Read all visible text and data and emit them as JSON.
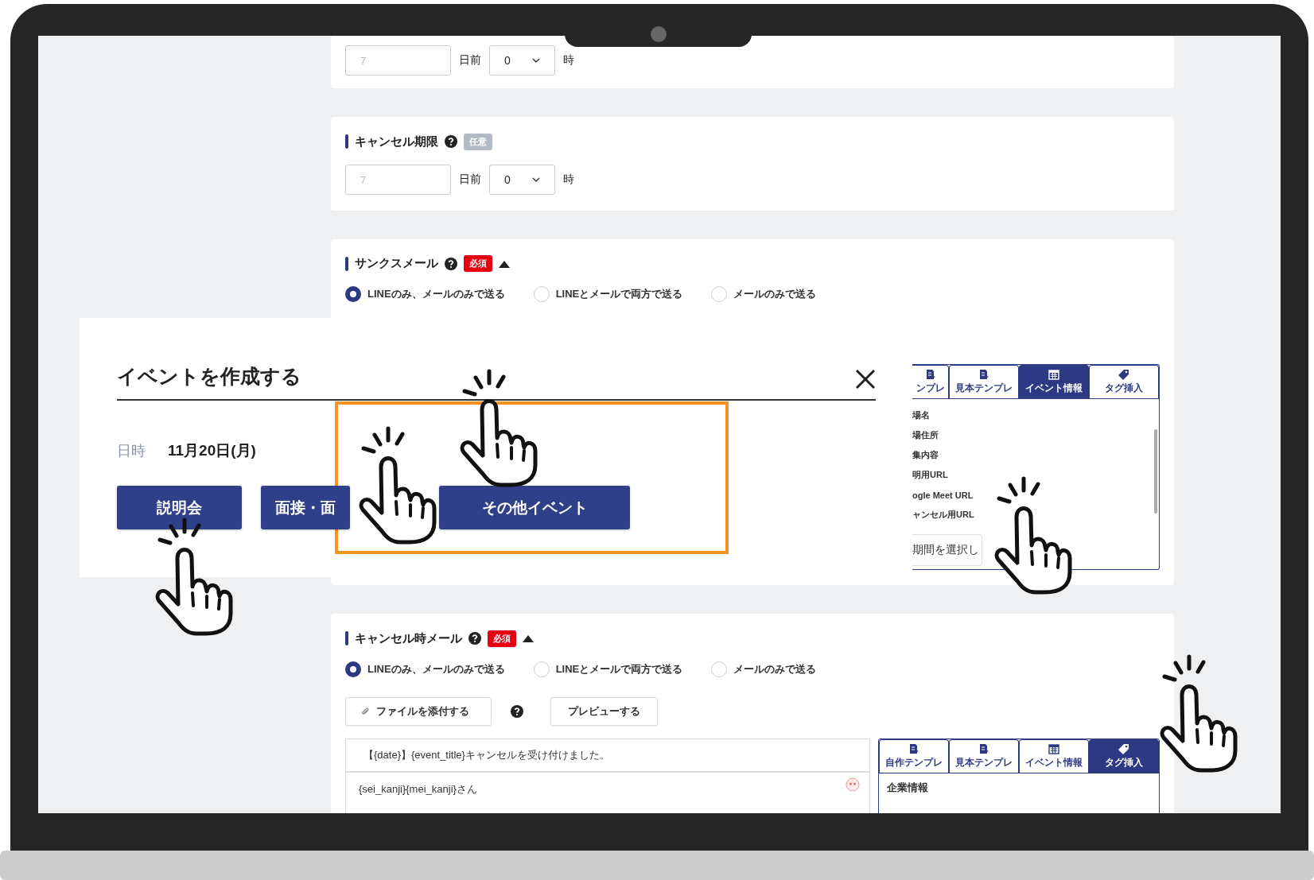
{
  "sections": [
    {
      "kind": "deadline",
      "days_placeholder": "7",
      "days_unit": "日前",
      "hour_value": "0",
      "hour_unit": "時"
    },
    {
      "kind": "deadline",
      "title": "キャンセル期限",
      "badge": {
        "text": "任意",
        "required": false
      },
      "days_placeholder": "7",
      "days_unit": "日前",
      "hour_value": "0",
      "hour_unit": "時"
    },
    {
      "kind": "mail",
      "title": "サンクスメール",
      "badge": {
        "text": "必須",
        "required": true
      },
      "expanded": true,
      "radios": [
        {
          "label": "LINEのみ、メールのみで送る",
          "selected": true
        },
        {
          "label": "LINEとメールで両方で送る",
          "selected": false
        },
        {
          "label": "メールのみで送る",
          "selected": false
        }
      ],
      "tag_panel": {
        "tabs": [
          {
            "label": "ンプレ",
            "selected": false
          },
          {
            "label": "見本テンプレ",
            "selected": false
          },
          {
            "label": "イベント情報",
            "selected": true
          },
          {
            "label": "タグ挿入",
            "selected": false
          }
        ],
        "items": [
          "場名",
          "場住所",
          "集内容",
          "明用URL",
          "ogle Meet URL",
          "ャンセル用URL"
        ],
        "select": "期間を選択し"
      }
    },
    {
      "kind": "mail",
      "title": "キャンセル時メール",
      "badge": {
        "text": "必須",
        "required": true
      },
      "expanded": true,
      "radios": [
        {
          "label": "LINEのみ、メールのみで送る",
          "selected": true
        },
        {
          "label": "LINEとメールで両方で送る",
          "selected": false
        },
        {
          "label": "メールのみで送る",
          "selected": false
        }
      ],
      "attach_button": "ファイルを添付する",
      "preview_button": "プレビューする",
      "editor": {
        "subject": "【{date}】{event_title}キャンセルを受け付けました。",
        "body": "{sei_kanji}{mei_kanji}さん"
      },
      "tag_panel": {
        "tabs": [
          {
            "label": "自作テンプレ",
            "selected": false
          },
          {
            "label": "見本テンプレ",
            "selected": false
          },
          {
            "label": "イベント情報",
            "selected": false
          },
          {
            "label": "タグ挿入",
            "selected": true
          }
        ],
        "items": [
          "企業情報"
        ]
      }
    }
  ],
  "modal": {
    "title": "イベントを作成する",
    "date_label": "日時",
    "date": "11月20日(月)",
    "buttons": [
      "説明会",
      "面接・面",
      "その他イベント"
    ]
  }
}
